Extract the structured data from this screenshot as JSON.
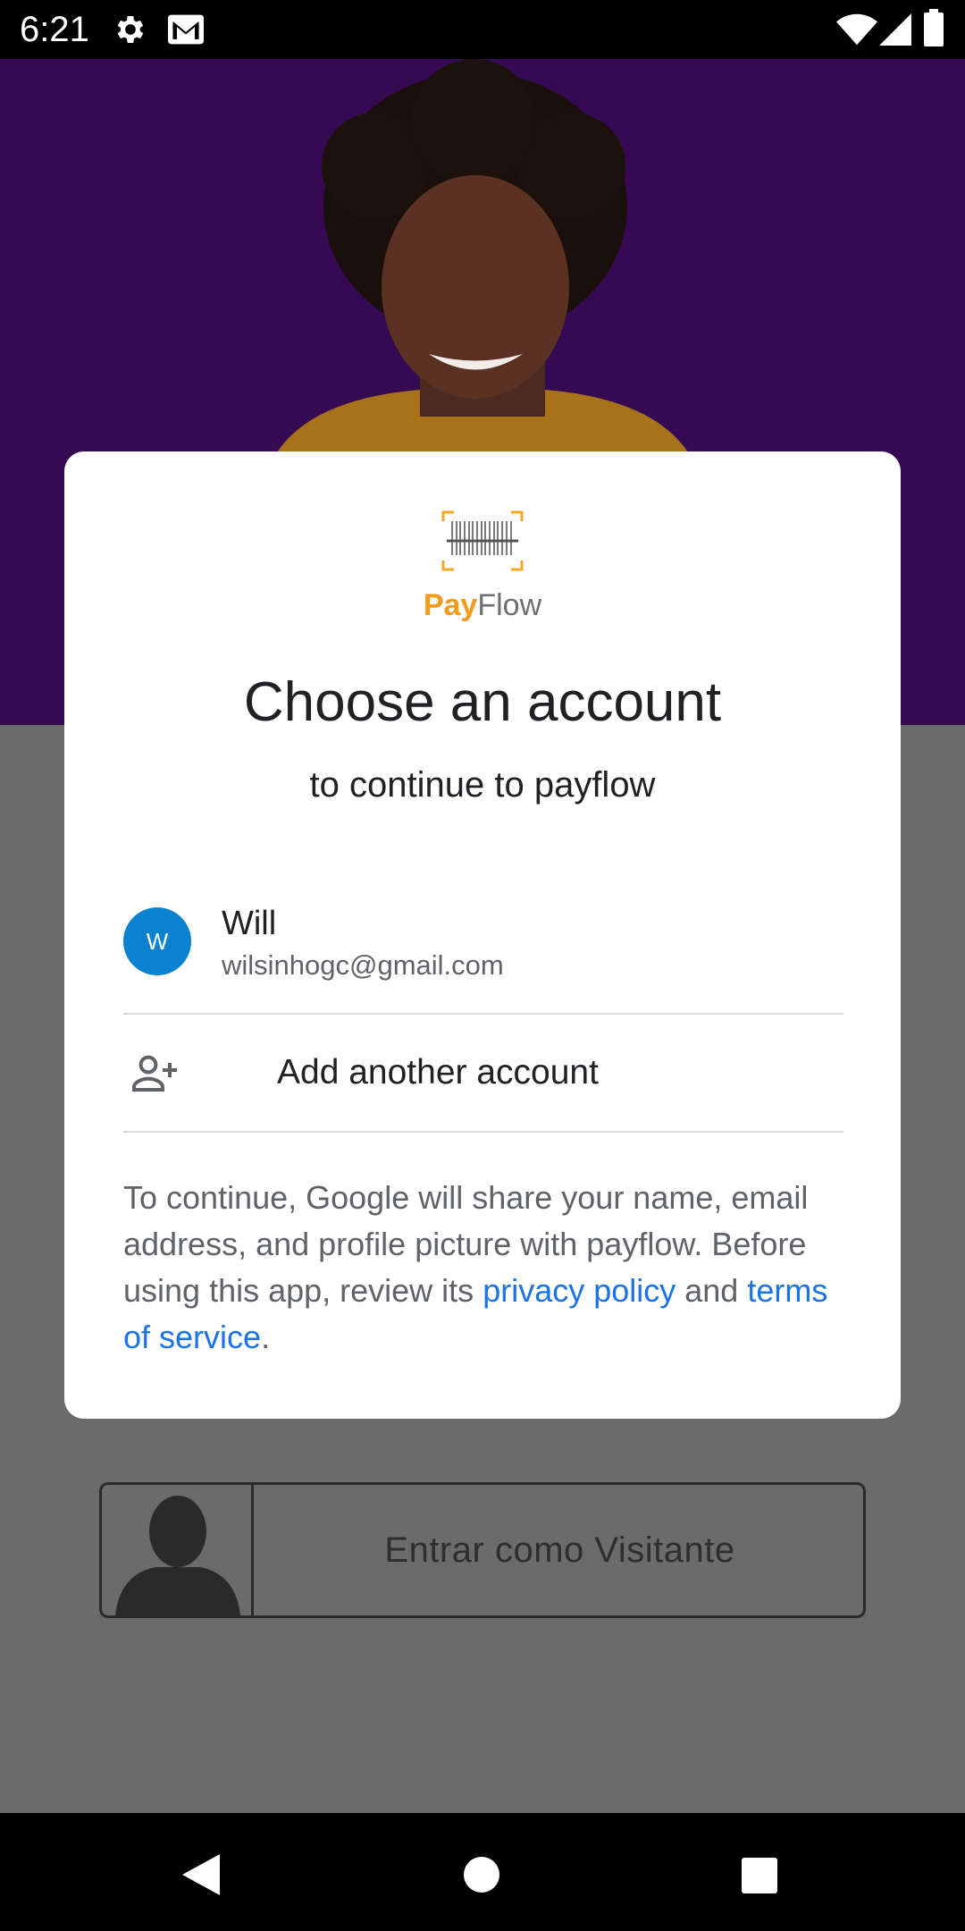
{
  "status_bar": {
    "time": "6:21",
    "icons": [
      "gear-icon",
      "gmail-icon",
      "wifi-icon",
      "signal-icon",
      "battery-icon"
    ]
  },
  "background_app": {
    "guest_button_label": "Entrar como Visitante",
    "hero_color": "#360a52"
  },
  "dialog": {
    "brand": {
      "pay": "Pay",
      "flow": "Flow"
    },
    "title": "Choose an account",
    "subtitle": "to continue to payflow",
    "account": {
      "avatar_letter": "W",
      "name": "Will",
      "email": "wilsinhogc@gmail.com"
    },
    "add_account_label": "Add another account",
    "disclaimer": {
      "text": "To continue, Google will share your name, email address, and profile picture with payflow. Before using this app, review its ",
      "privacy_link": "privacy policy",
      "and": " and ",
      "terms_link": "terms of service",
      "end": "."
    }
  },
  "colors": {
    "accent_link": "#1a73e8",
    "avatar_blue": "#0b82d0",
    "brand_orange": "#f59a1b",
    "scrim": "#6b6b6b"
  }
}
